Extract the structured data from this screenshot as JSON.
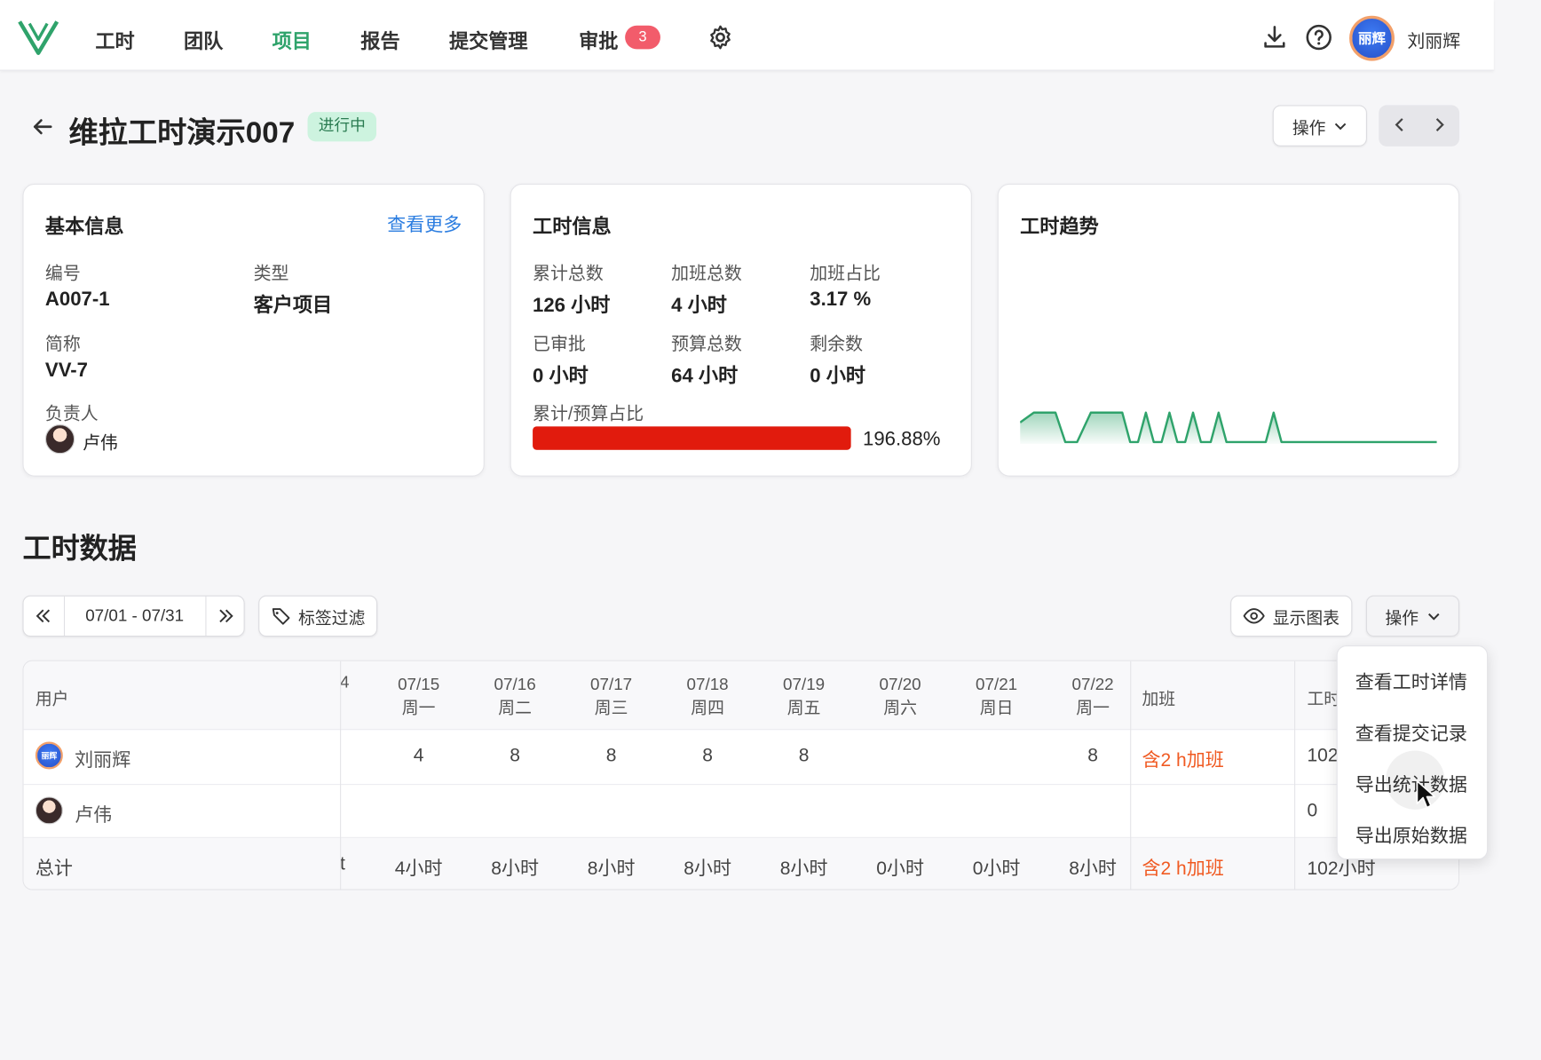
{
  "nav": {
    "items": [
      "工时",
      "团队",
      "项目",
      "报告",
      "提交管理",
      "审批"
    ],
    "active": "项目",
    "approval_badge": "3",
    "user_name": "刘丽辉",
    "avatar_text": "丽辉"
  },
  "header": {
    "title": "维拉工时演示007",
    "status": "进行中",
    "actions_label": "操作"
  },
  "basic_info": {
    "title": "基本信息",
    "more_link": "查看更多",
    "code_label": "编号",
    "code_value": "A007-1",
    "type_label": "类型",
    "type_value": "客户项目",
    "short_label": "简称",
    "short_value": "VV-7",
    "owner_label": "负责人",
    "owner_name": "卢伟"
  },
  "hours_info": {
    "title": "工时信息",
    "total_label": "累计总数",
    "total_value": "126 小时",
    "overtime_label": "加班总数",
    "overtime_value": "4 小时",
    "overtime_ratio_label": "加班占比",
    "overtime_ratio_value": "3.17 %",
    "approved_label": "已审批",
    "approved_value": "0 小时",
    "budget_label": "预算总数",
    "budget_value": "64 小时",
    "remaining_label": "剩余数",
    "remaining_value": "0 小时",
    "ratio_label": "累计/预算占比",
    "ratio_value": "196.88%",
    "ratio_fill": 1.0,
    "bar_color": "#e11b0d"
  },
  "trend": {
    "title": "工时趋势",
    "line_color": "#2fa36b"
  },
  "section": {
    "title": "工时数据",
    "date_range": "07/01 - 07/31",
    "tag_filter": "标签过滤",
    "show_chart": "显示图表",
    "actions": "操作"
  },
  "table": {
    "user_header": "用户",
    "days": [
      {
        "date": "07/15",
        "weekday": "周一"
      },
      {
        "date": "07/16",
        "weekday": "周二"
      },
      {
        "date": "07/17",
        "weekday": "周三"
      },
      {
        "date": "07/18",
        "weekday": "周四"
      },
      {
        "date": "07/19",
        "weekday": "周五"
      },
      {
        "date": "07/20",
        "weekday": "周六"
      },
      {
        "date": "07/21",
        "weekday": "周日"
      },
      {
        "date": "07/22",
        "weekday": "周一"
      }
    ],
    "partial_left_head": "4",
    "overtime_header": "加班",
    "hours_header": "工时",
    "rows": [
      {
        "name": "刘丽辉",
        "values": [
          "4",
          "8",
          "8",
          "8",
          "8",
          "",
          "",
          "8"
        ],
        "overtime": "含2 h加班",
        "hours": "102"
      },
      {
        "name": "卢伟",
        "values": [
          "",
          "",
          "",
          "",
          "",
          "",
          "",
          ""
        ],
        "overtime": "",
        "hours": "0"
      }
    ],
    "total": {
      "label": "总计",
      "partial_left": "t",
      "values": [
        "4小时",
        "8小时",
        "8小时",
        "8小时",
        "8小时",
        "0小时",
        "0小时",
        "8小时"
      ],
      "overtime": "含2 h加班",
      "hours": "102小时"
    }
  },
  "dropdown": {
    "items": [
      "查看工时详情",
      "查看提交记录",
      "导出统计数据",
      "导出原始数据"
    ]
  }
}
